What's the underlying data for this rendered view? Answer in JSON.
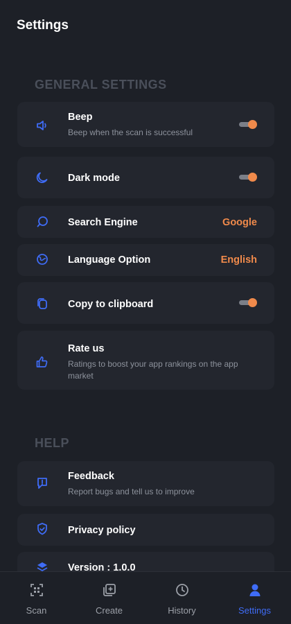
{
  "header": {
    "title": "Settings"
  },
  "colors": {
    "accent": "#3f6cf6",
    "value_accent": "#f08a4b",
    "background": "#1d2027",
    "card": "#23262e"
  },
  "general": {
    "title": "GENERAL SETTINGS",
    "beep": {
      "label": "Beep",
      "sub": "Beep when the scan is successful",
      "icon": "speaker-icon",
      "on": true
    },
    "dark_mode": {
      "label": "Dark mode",
      "icon": "moon-icon",
      "on": true
    },
    "search_engine": {
      "label": "Search Engine",
      "value": "Google",
      "icon": "search-chat-icon"
    },
    "language": {
      "label": "Language Option",
      "value": "English",
      "icon": "globe-icon"
    },
    "clipboard": {
      "label": "Copy to clipboard",
      "icon": "copy-icon",
      "on": true
    },
    "rate": {
      "label": "Rate us",
      "sub": "Ratings to boost your app rankings on the app market",
      "icon": "thumbs-up-icon"
    }
  },
  "help": {
    "title": "HELP",
    "feedback": {
      "label": "Feedback",
      "sub": "Report bugs and tell us to improve",
      "icon": "feedback-icon"
    },
    "privacy": {
      "label": "Privacy policy",
      "icon": "shield-icon"
    },
    "version": {
      "label": "Version : 1.0.0",
      "icon": "layers-icon"
    }
  },
  "nav": {
    "scan": {
      "label": "Scan",
      "icon": "scan-icon"
    },
    "create": {
      "label": "Create",
      "icon": "create-icon"
    },
    "history": {
      "label": "History",
      "icon": "history-icon"
    },
    "settings": {
      "label": "Settings",
      "icon": "user-icon",
      "active": true
    }
  }
}
